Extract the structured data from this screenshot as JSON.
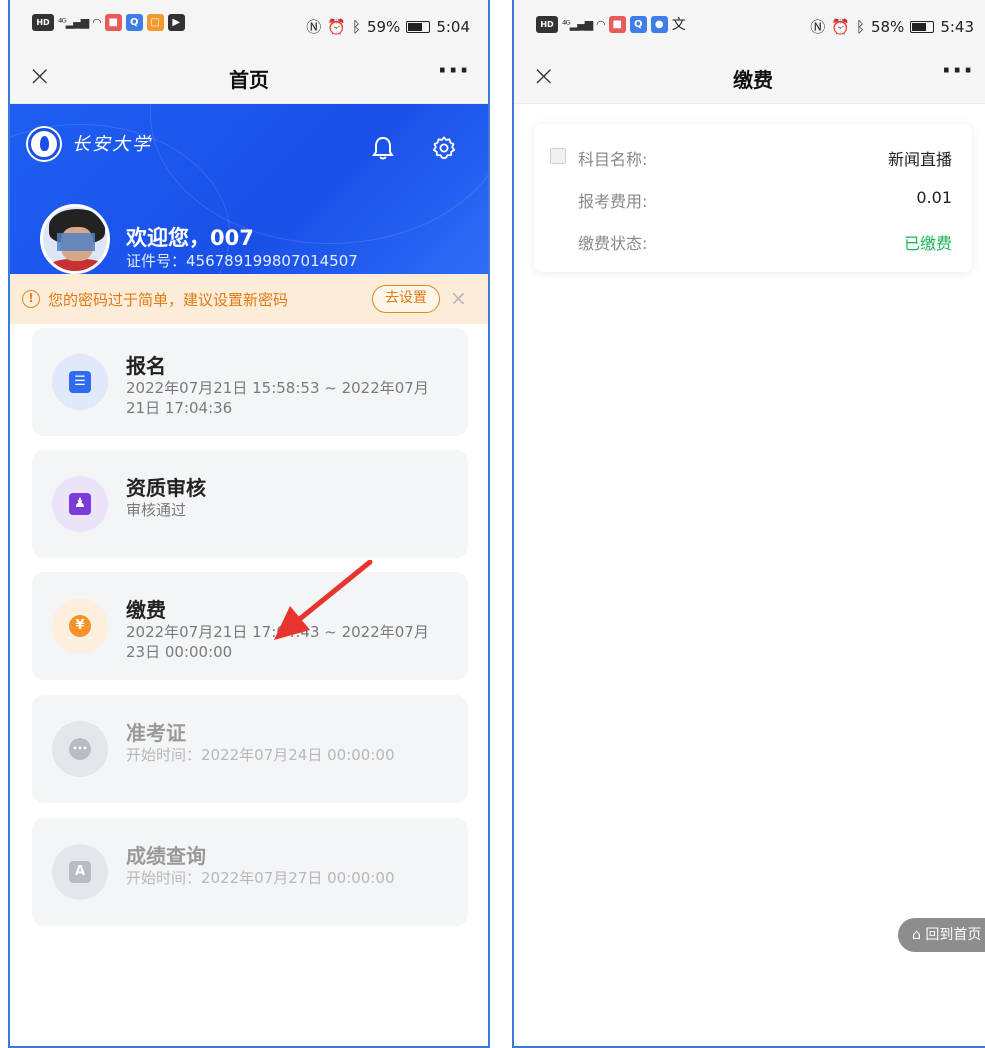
{
  "left": {
    "status": {
      "time": "5:04",
      "battery": "59%"
    },
    "nav": {
      "title": "首页",
      "close": "×",
      "more": "···"
    },
    "header": {
      "logo_text": "长安大学",
      "welcome": "欢迎您，007",
      "id_label": "证件号：456789199807014507"
    },
    "notice": {
      "text": "您的密码过于简单，建议设置新密码",
      "button": "去设置",
      "close": "×"
    },
    "cards": [
      {
        "title": "报名",
        "sub": "2022年07月21日 15:58:53 ~ 2022年07月21日 17:04:36",
        "icon": "document-icon",
        "color": "#2f6bf0",
        "bg": "#dfe9fb",
        "disabled": false
      },
      {
        "title": "资质审核",
        "sub": "审核通过",
        "icon": "stamp-icon",
        "color": "#7a3bd6",
        "bg": "#ebe3f8",
        "disabled": false
      },
      {
        "title": "缴费",
        "sub": "2022年07月21日 17:04:43 ~ 2022年07月23日 00:00:00",
        "icon": "yuan-icon",
        "color": "#f5902a",
        "bg": "#fdeede",
        "disabled": false
      },
      {
        "title": "准考证",
        "sub": "开始时间：2022年07月24日 00:00:00",
        "icon": "chat-icon",
        "color": "#b7bcc7",
        "bg": "#e4e6ea",
        "disabled": true
      },
      {
        "title": "成绩查询",
        "sub": "开始时间：2022年07月27日 00:00:00",
        "icon": "score-icon",
        "color": "#b7bcc7",
        "bg": "#e4e6ea",
        "disabled": true
      }
    ]
  },
  "right": {
    "status": {
      "time": "5:43",
      "battery": "58%"
    },
    "nav": {
      "title": "缴费",
      "close": "×",
      "more": "···"
    },
    "payment": {
      "rows": [
        {
          "label": "科目名称:",
          "value": "新闻直播"
        },
        {
          "label": "报考费用:",
          "value": "0.01"
        },
        {
          "label": "缴费状态:",
          "value": "已缴费"
        }
      ]
    },
    "home_button": "回到首页"
  }
}
